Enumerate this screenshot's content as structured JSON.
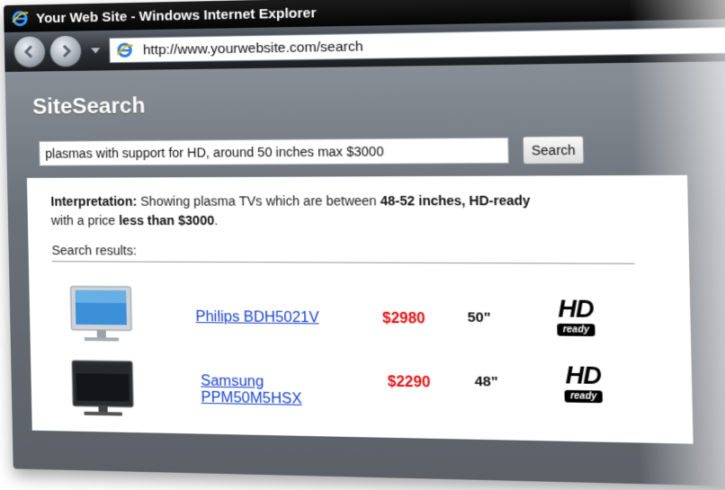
{
  "browser": {
    "title": "Your Web Site - Windows Internet Explorer",
    "url": "http://www.yourwebsite.com/search"
  },
  "site": {
    "title": "SiteSearch"
  },
  "search": {
    "query": "plasmas with support for HD, around 50 inches max $3000",
    "button_label": "Search"
  },
  "interpretation": {
    "label": "Interpretation:",
    "text_1": " Showing plasma TVs which are between ",
    "bold_1": "48-52 inches, HD-ready",
    "text_2": "with a price ",
    "bold_2": "less than $3000",
    "text_3": "."
  },
  "results_label": "Search results:",
  "results": [
    {
      "name": "Philips BDH5021V",
      "price": "$2980",
      "size": "50\"",
      "badge_top": "HD",
      "badge_bottom": "ready"
    },
    {
      "name": "Samsung PPM50M5HSX",
      "name_line1": "Samsung",
      "name_line2": "PPM50M5HSX",
      "price": "$2290",
      "size": "48\"",
      "badge_top": "HD",
      "badge_bottom": "ready"
    }
  ],
  "colors": {
    "link": "#1a44c8",
    "price": "#e01010",
    "titlebar": "#0a0a0a"
  },
  "icons": {
    "browser_logo": "ie-logo-icon",
    "back": "back-arrow-icon",
    "forward": "forward-arrow-icon"
  }
}
